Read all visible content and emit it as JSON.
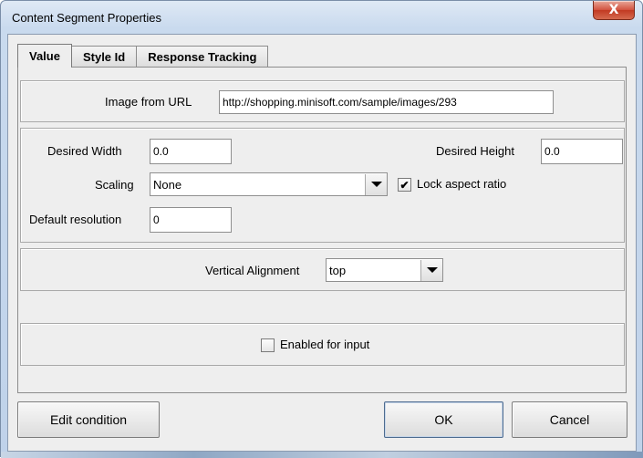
{
  "window": {
    "title": "Content Segment Properties",
    "close_glyph": "X"
  },
  "tabs": [
    {
      "label": "Value",
      "active": true
    },
    {
      "label": "Style Id",
      "active": false
    },
    {
      "label": "Response Tracking",
      "active": false
    }
  ],
  "image": {
    "label": "Image from URL",
    "value": "http://shopping.minisoft.com/sample/images/293"
  },
  "size": {
    "width_label": "Desired Width",
    "width_value": "0.0",
    "height_label": "Desired Height",
    "height_value": "0.0",
    "scaling_label": "Scaling",
    "scaling_value": "None",
    "lock_label": "Lock aspect ratio",
    "lock_checked": true,
    "lock_mark": "✔",
    "resolution_label": "Default resolution",
    "resolution_value": "0"
  },
  "alignment": {
    "label": "Vertical Alignment",
    "value": "top"
  },
  "input": {
    "label": "Enabled for input",
    "checked": false
  },
  "buttons": {
    "edit_condition": "Edit condition",
    "ok": "OK",
    "cancel": "Cancel"
  }
}
